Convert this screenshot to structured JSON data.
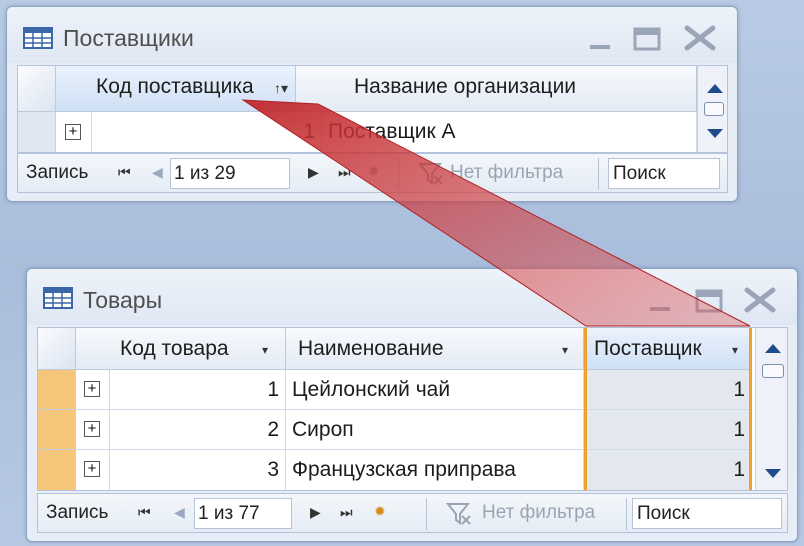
{
  "suppliers_window": {
    "title": "Поставщики",
    "columns": [
      "Код поставщика",
      "Название организации"
    ],
    "rows": [
      {
        "code": "1",
        "name": "Поставщик А"
      }
    ],
    "nav": {
      "record_label": "Запись",
      "position": "1 из 29",
      "filter_label": "Нет фильтра",
      "search_label": "Поиск"
    }
  },
  "products_window": {
    "title": "Товары",
    "columns": [
      "Код товара",
      "Наименование",
      "Поставщик"
    ],
    "rows": [
      {
        "code": "1",
        "name": "Цейлонский чай",
        "supplier": "1"
      },
      {
        "code": "2",
        "name": "Сироп",
        "supplier": "1"
      },
      {
        "code": "3",
        "name": "Французская приправа",
        "supplier": "1"
      }
    ],
    "nav": {
      "record_label": "Запись",
      "position": "1 из 77",
      "filter_label": "Нет фильтра",
      "search_label": "Поиск"
    }
  },
  "icons": {
    "window_icon": "table-icon",
    "relationship": "red-relationship-connector"
  },
  "colors": {
    "relationship": "#d23a3a",
    "highlight_column": "#f0a030",
    "text_gray": "#4f4f4f"
  }
}
